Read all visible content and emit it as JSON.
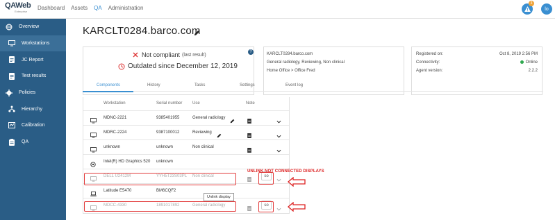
{
  "app": {
    "logo": "QAWeb",
    "logo_sub": "Enterprise",
    "nav": [
      "Dashboard",
      "Assets",
      "QA",
      "Administration"
    ],
    "nav_active": "QA",
    "alert_count": "3",
    "alert_icon": "warning-triangle",
    "user_initials": "lo"
  },
  "sidebar": {
    "items": [
      {
        "label": "Overview",
        "icon": "globe-icon"
      },
      {
        "label": "Workstations",
        "icon": "monitor-icon"
      },
      {
        "label": "JC Report",
        "icon": "document-icon"
      },
      {
        "label": "Test results",
        "icon": "document-icon"
      },
      {
        "label": "Policies",
        "icon": "gear-icon"
      },
      {
        "label": "Hierarchy",
        "icon": "hierarchy-icon"
      },
      {
        "label": "Calibration",
        "icon": "calibration-icon"
      },
      {
        "label": "QA",
        "icon": "clipboard-icon"
      }
    ]
  },
  "page": {
    "title": "KARCLT0284.barco.com",
    "status_main": "Not compliant",
    "status_note": "(last result)",
    "outdated": "Outdated since December 12, 2019",
    "info": {
      "name": "KARCLT0284.barco.com",
      "tags": "General radiology, Reviewing, Non clinical",
      "location": "Home Office > Office Fred"
    },
    "registration": {
      "registered_label": "Registered on:",
      "registered_value": "Oct 8, 2019 2:56 PM",
      "connectivity_label": "Connectivity:",
      "connectivity_value": "Online",
      "agent_label": "Agent version:",
      "agent_value": "2.2.2"
    },
    "tabs": [
      "Components",
      "History",
      "Tasks",
      "Settings",
      "Event log"
    ]
  },
  "table": {
    "headers": [
      "Workstation",
      "Serial number",
      "Use",
      "Note"
    ],
    "rows": [
      {
        "name": "MDNC-2221",
        "serial": "9385401955",
        "use": "General radiology",
        "icon": "monitor-icon",
        "pencil": true,
        "note": true,
        "unlink": false,
        "dim": false
      },
      {
        "name": "MDRC-2224",
        "serial": "9387100012",
        "use": "Reviewing",
        "icon": "monitor-icon",
        "pencil": true,
        "note": true,
        "unlink": false,
        "dim": false
      },
      {
        "name": "unknown",
        "serial": "unknown",
        "use": "Non clinical",
        "icon": "monitor-icon",
        "pencil": false,
        "note": true,
        "unlink": false,
        "dim": false
      },
      {
        "name": "Intel(R) HD Graphics 520",
        "serial": "unknown",
        "use": "",
        "icon": "gpu-icon",
        "pencil": false,
        "note": false,
        "unlink": false,
        "dim": false
      },
      {
        "name": "DELL U2412M",
        "serial": "YYH5T23S03PL",
        "use": "Non clinical",
        "icon": "monitor-icon",
        "pencil": false,
        "note": true,
        "unlink": true,
        "dim": true
      },
      {
        "name": "Latitude E5470",
        "serial": "BM6CQF2",
        "use": "",
        "icon": "laptop-icon",
        "pencil": false,
        "note": false,
        "unlink": false,
        "dim": false
      },
      {
        "name": "MDCC-4330",
        "serial": "1891017892",
        "use": "General radiology",
        "icon": "monitor-icon",
        "pencil": false,
        "note": true,
        "unlink": true,
        "dim": true
      }
    ],
    "unlink_label": "so"
  },
  "annotations": {
    "callout": "UNLINK NOT CONNECTED DISPLAYS",
    "tooltip": "Unlink display"
  },
  "colors": {
    "sidebar": "#2a5d86",
    "accent": "#3a8fd1",
    "annotation": "#e23a3a",
    "online": "#2fa84f"
  }
}
